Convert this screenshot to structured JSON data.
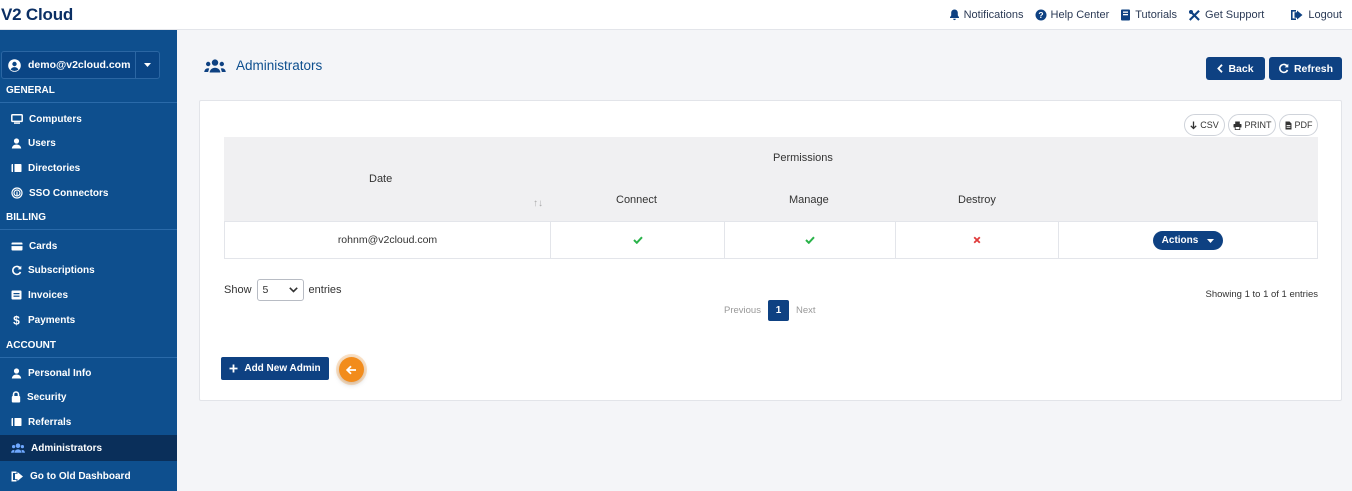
{
  "app": {
    "brand": "V2 Cloud"
  },
  "topnav": [
    {
      "label": "Notifications",
      "icon": "bell-icon"
    },
    {
      "label": "Help Center",
      "icon": "question-circle-icon"
    },
    {
      "label": "Tutorials",
      "icon": "book-icon"
    },
    {
      "label": "Get Support",
      "icon": "tools-icon"
    },
    {
      "label": "Logout",
      "icon": "logout-icon"
    }
  ],
  "sidebar": {
    "account_email": "demo@v2cloud.com",
    "general_heading": "GENERAL",
    "general_items": [
      "Computers",
      "Users",
      "Directories",
      "SSO Connectors"
    ],
    "billing_heading": "BILLING",
    "billing_items": [
      "Cards",
      "Subscriptions",
      "Invoices",
      "Payments"
    ],
    "account_heading": "ACCOUNT",
    "account_items": [
      "Personal Info",
      "Security",
      "Referrals",
      "Administrators"
    ],
    "old_dashboard": "Go to Old Dashboard",
    "active_item": "Administrators"
  },
  "page": {
    "title": "Administrators",
    "back_label": "Back",
    "refresh_label": "Refresh"
  },
  "export": {
    "csv": "CSV",
    "print": "PRINT",
    "pdf": "PDF"
  },
  "table": {
    "col_date": "Date",
    "group_permissions": "Permissions",
    "col_connect": "Connect",
    "col_manage": "Manage",
    "col_destroy": "Destroy",
    "sort_glyph": "↑↓",
    "rows": [
      {
        "email": "rohnm@v2cloud.com",
        "connect": true,
        "manage": true,
        "destroy": false,
        "actions_label": "Actions"
      }
    ]
  },
  "pagination": {
    "show_label": "Show",
    "entries_label": "entries",
    "page_size": "5",
    "previous": "Previous",
    "current_page": "1",
    "next": "Next",
    "showing_text": "Showing 1 to 1 of 1 entries"
  },
  "add_button_label": "Add New Admin",
  "colors": {
    "sidebar_bg": "#0e4f8e",
    "primary": "#0e4182",
    "accent_orange": "#f28c1c",
    "check_green": "#2ab34a",
    "cross_red": "#e03a3a"
  }
}
